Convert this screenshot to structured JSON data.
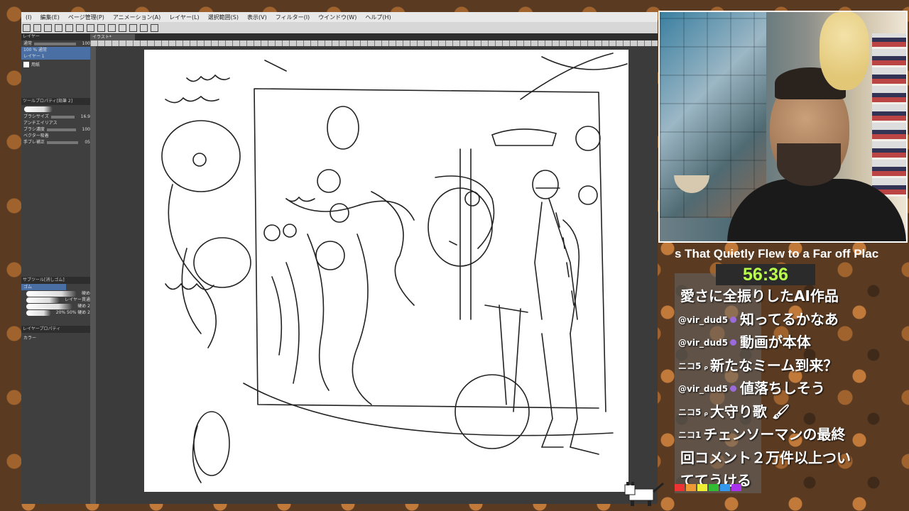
{
  "app": {
    "menu": [
      "(I)",
      "編集(E)",
      "ページ管理(P)",
      "アニメーション(A)",
      "レイヤー(L)",
      "選択範囲(S)",
      "表示(V)",
      "フィルター(I)",
      "ウインドウ(W)",
      "ヘルプ(H)"
    ],
    "canvas_tab": "イラスト*",
    "left_panel": {
      "layer_header": "レイヤー",
      "blend_mode": "通常",
      "opacity_value": "100",
      "layer1_name": "100 % 通常",
      "layer1_sub": "レイヤー 1",
      "layer2_name": "用紙",
      "tool_header": "ツールプロパティ[鉛筆 2]",
      "size_label": "ブラシサイズ",
      "size_value": "16.9",
      "brush_shape_label": "アンチエイリアス",
      "density_label": "ブラシ濃度",
      "density_value": "100",
      "color_label": "ベクター吸着",
      "stabilize_label": "手ブレ補正",
      "stabilize_value": "05",
      "subtool_header": "サブツール[消しゴム]",
      "subtool_sel": "ゴム",
      "subtools": [
        "硬め",
        "レイヤー貫通",
        "硬め 2",
        "20% 50% 硬め 2"
      ],
      "layer_prop_header": "レイヤープロパティ",
      "color_mode": "カラー"
    }
  },
  "stream": {
    "title": "s That Quietly Flew to a Far off Plac",
    "timer": "56:36",
    "comments": [
      {
        "user": "",
        "text": "愛さに全振りしたAI作品"
      },
      {
        "user": "@vir_dud5",
        "text": "知ってるかなあ"
      },
      {
        "user": "@vir_dud5",
        "text": "動画が本体"
      },
      {
        "user": "ニコ5 ᵨ",
        "text": "新たなミーム到来？"
      },
      {
        "user": "@vir_dud5",
        "text": "値落ちしそう"
      },
      {
        "user": "ニコ5 ᵨ",
        "text": "大守り歌 🖌"
      },
      {
        "user": "ニコ1",
        "text": "チェンソーマンの最終"
      },
      {
        "user": "",
        "text": "回コメント２万件以上つい"
      },
      {
        "user": "",
        "text": "ててうける"
      }
    ],
    "colors": {
      "timer": "#b9ff4a",
      "badge": "#9b6bdb"
    }
  }
}
